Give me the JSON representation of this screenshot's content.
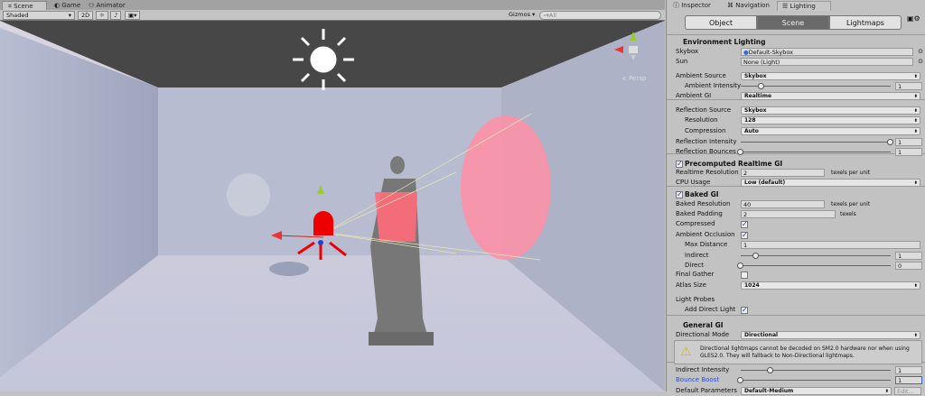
{
  "scene_panel": {
    "tabs": [
      {
        "label": "Scene",
        "icon": "hash-icon"
      },
      {
        "label": "Game",
        "icon": "pacman-icon"
      },
      {
        "label": "Animator",
        "icon": "animator-icon"
      }
    ],
    "toolbar": {
      "shading": "Shaded",
      "mode_2d": "2D",
      "gizmos": "Gizmos",
      "search_placeholder": "All"
    },
    "persp_label": "< Persp"
  },
  "inspector": {
    "tabs": [
      {
        "label": "Inspector"
      },
      {
        "label": "Navigation"
      },
      {
        "label": "Lighting"
      }
    ],
    "segments": [
      "Object",
      "Scene",
      "Lightmaps"
    ],
    "rows": [
      {
        "type": "header",
        "label": "Environment Lighting"
      },
      {
        "type": "field",
        "label": "Skybox",
        "value": "Default-Skybox",
        "wide": true
      },
      {
        "type": "field",
        "label": "Sun",
        "value": "None (Light)",
        "wide": true
      },
      {
        "type": "dropdown",
        "label": "Ambient Source",
        "value": "Skybox"
      },
      {
        "type": "slider",
        "label": "Ambient Intensity",
        "value": "1",
        "fraction": 0.14,
        "indent": true
      },
      {
        "type": "dropdown",
        "label": "Ambient GI",
        "value": "Realtime"
      },
      {
        "type": "dropdown",
        "label": "Reflection Source",
        "value": "Skybox"
      },
      {
        "type": "dropdown",
        "label": "Resolution",
        "value": "128",
        "indent": true
      },
      {
        "type": "dropdown",
        "label": "Compression",
        "value": "Auto",
        "indent": true
      },
      {
        "type": "slider",
        "label": "Reflection Intensity",
        "value": "1",
        "fraction": 1
      },
      {
        "type": "slider",
        "label": "Reflection Bounces",
        "value": "1",
        "fraction": 0
      },
      {
        "type": "checkheader",
        "label": "Precomputed Realtime GI",
        "checked": true
      },
      {
        "type": "field",
        "label": "Realtime Resolution",
        "value": "2",
        "unit": "texels per unit"
      },
      {
        "type": "dropdown",
        "label": "CPU Usage",
        "value": "Low (default)"
      },
      {
        "type": "checkheader",
        "label": "Baked GI",
        "checked": true
      },
      {
        "type": "field",
        "label": "Baked Resolution",
        "value": "40",
        "unit": "texels per unit"
      },
      {
        "type": "field",
        "label": "Baked Padding",
        "value": "2",
        "unit": "texels"
      },
      {
        "type": "check",
        "label": "Compressed",
        "checked": true
      },
      {
        "type": "check",
        "label": "Ambient Occlusion",
        "checked": true
      },
      {
        "type": "field",
        "label": "Max Distance",
        "value": "1",
        "indent": true,
        "full": true
      },
      {
        "type": "slider",
        "label": "Indirect",
        "value": "1",
        "fraction": 0.1,
        "indent": true
      },
      {
        "type": "slider",
        "label": "Direct",
        "value": "0",
        "fraction": 0,
        "indent": true
      },
      {
        "type": "check",
        "label": "Final Gather",
        "checked": false
      },
      {
        "type": "dropdown",
        "label": "Atlas Size",
        "value": "1024"
      },
      {
        "type": "label",
        "label": "Light Probes"
      },
      {
        "type": "check",
        "label": "Add Direct Light",
        "checked": true,
        "indent": true
      },
      {
        "type": "header",
        "label": "General GI"
      },
      {
        "type": "dropdown",
        "label": "Directional Mode",
        "value": "Directional"
      },
      {
        "type": "slider",
        "label": "Indirect Intensity",
        "value": "1",
        "fraction": 0.2
      },
      {
        "type": "slider",
        "label": "Bounce Boost",
        "value": "1",
        "fraction": 0,
        "blue": true
      },
      {
        "type": "dropdown",
        "label": "Default Parameters",
        "value": "Default-Medium",
        "edit": "Edit..."
      }
    ],
    "warning": "Directional lightmaps cannot be decoded on SM2.0 hardware nor when using GLES2.0. They will fallback to Non-Directional lightmaps."
  }
}
